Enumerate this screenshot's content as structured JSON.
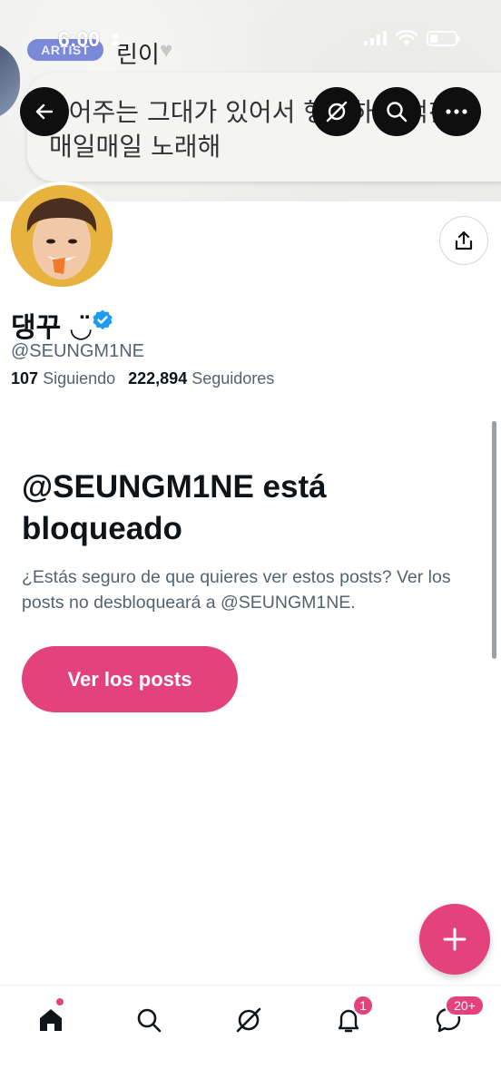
{
  "status_bar": {
    "time": "6:00"
  },
  "banner": {
    "pill": "ARTIST",
    "name": "린이",
    "lyric_line1": "좋어주는 그대가 있어서 행복하고 벅찬",
    "lyric_line2": "매일매일 노래해"
  },
  "profile": {
    "display_name": "댕꾸 ◡̈",
    "handle": "@SEUNGM1NE",
    "following_count": "107",
    "following_label": "Siguiendo",
    "followers_count": "222,894",
    "followers_label": "Seguidores"
  },
  "blocked": {
    "title": "@SEUNGM1NE está bloqueado",
    "description": "¿Estás seguro de que quieres ver estos posts? Ver los posts no desbloqueará a @SEUNGM1NE.",
    "button": "Ver los posts"
  },
  "tabbar": {
    "notifications_badge": "1",
    "messages_badge": "20+"
  },
  "colors": {
    "accent": "#e4427c",
    "verified": "#1d9bf0",
    "text_secondary": "#536471"
  },
  "icons": {
    "back": "arrow-left-icon",
    "grok": "grok-icon",
    "search": "search-icon",
    "more": "more-horizontal-icon",
    "share": "share-icon",
    "home": "home-icon",
    "bell": "bell-icon",
    "messages": "messages-icon",
    "compose": "plus-icon"
  }
}
